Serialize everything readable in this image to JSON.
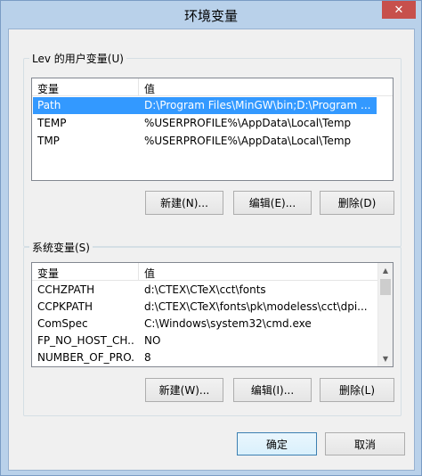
{
  "window": {
    "title": "环境变量",
    "close_glyph": "✕"
  },
  "user_vars": {
    "group_label": "Lev 的用户变量(U)",
    "columns": [
      "变量",
      "值"
    ],
    "rows": [
      {
        "name": "Path",
        "value": "D:\\Program Files\\MinGW\\bin;D:\\Program ...",
        "selected": true
      },
      {
        "name": "TEMP",
        "value": "%USERPROFILE%\\AppData\\Local\\Temp"
      },
      {
        "name": "TMP",
        "value": "%USERPROFILE%\\AppData\\Local\\Temp"
      }
    ],
    "buttons": {
      "new": "新建(N)...",
      "edit": "编辑(E)...",
      "delete": "删除(D)"
    }
  },
  "system_vars": {
    "group_label": "系统变量(S)",
    "columns": [
      "变量",
      "值"
    ],
    "rows": [
      {
        "name": "CCHZPATH",
        "value": "d:\\CTEX\\CTeX\\cct\\fonts"
      },
      {
        "name": "CCPKPATH",
        "value": "d:\\CTEX\\CTeX\\fonts\\pk\\modeless\\cct\\dpi..."
      },
      {
        "name": "ComSpec",
        "value": "C:\\Windows\\system32\\cmd.exe"
      },
      {
        "name": "FP_NO_HOST_CH...",
        "value": "NO"
      },
      {
        "name": "NUMBER_OF_PRO...",
        "value": "8"
      }
    ],
    "buttons": {
      "new": "新建(W)...",
      "edit": "编辑(I)...",
      "delete": "删除(L)"
    },
    "scrollbar": {
      "up_glyph": "▲",
      "down_glyph": "▼"
    }
  },
  "dialog_buttons": {
    "ok": "确定",
    "cancel": "取消"
  }
}
